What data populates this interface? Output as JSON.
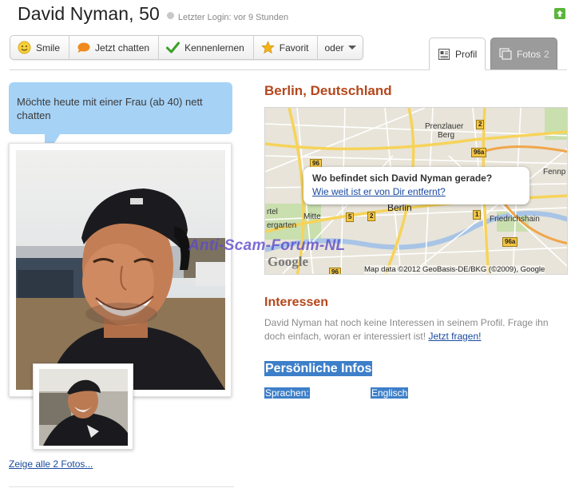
{
  "header": {
    "name": "David Nyman, 50",
    "last_login": "Letzter Login: vor 9 Stunden"
  },
  "toolbar": {
    "smile": "Smile",
    "chat": "Jetzt chatten",
    "meet": "Kennenlernen",
    "favorite": "Favorit",
    "or": "oder"
  },
  "tabs": {
    "profile": "Profil",
    "photos": "Fotos",
    "photos_count": "2"
  },
  "bubble": {
    "text": "Möchte heute mit einer Frau (ab 40) nett chatten"
  },
  "photos": {
    "all_link": "Zeige alle 2 Fotos..."
  },
  "location": {
    "title": "Berlin, Deutschland",
    "popup_question": "Wo befindet sich David Nyman gerade?",
    "popup_link": "Wie weit ist er von Dir entfernt?",
    "labels": {
      "prenzlauer": "Prenzlauer",
      "berg": "Berg",
      "mitte": "Mitte",
      "berlin": "Berlin",
      "friedrichshain": "Friedrichshain",
      "fennp": "Fennp",
      "rtel": "rtel",
      "ergarten": "ergarten"
    },
    "road_signs": [
      "2",
      "96a",
      "96",
      "5",
      "2",
      "1",
      "96a",
      "96"
    ],
    "google": "Google",
    "copyright": "Map data ©2012 GeoBasis-DE/BKG (©2009), Google"
  },
  "watermark": "Anti-Scam-Forum-NL",
  "interests": {
    "title": "Interessen",
    "text": "David Nyman hat noch keine Interessen in seinem Profil. Frage ihn doch einfach, woran er interessiert ist!",
    "link": "Jetzt fragen!"
  },
  "personal": {
    "title": "Persönliche Infos",
    "languages_label": "Sprachen:",
    "languages_value": "Englisch"
  },
  "colors": {
    "accent_orange": "#b4471c",
    "bubble_blue": "#a6d2f6",
    "highlight_blue": "#3d7fc9",
    "link_blue": "#1a4aa0"
  }
}
